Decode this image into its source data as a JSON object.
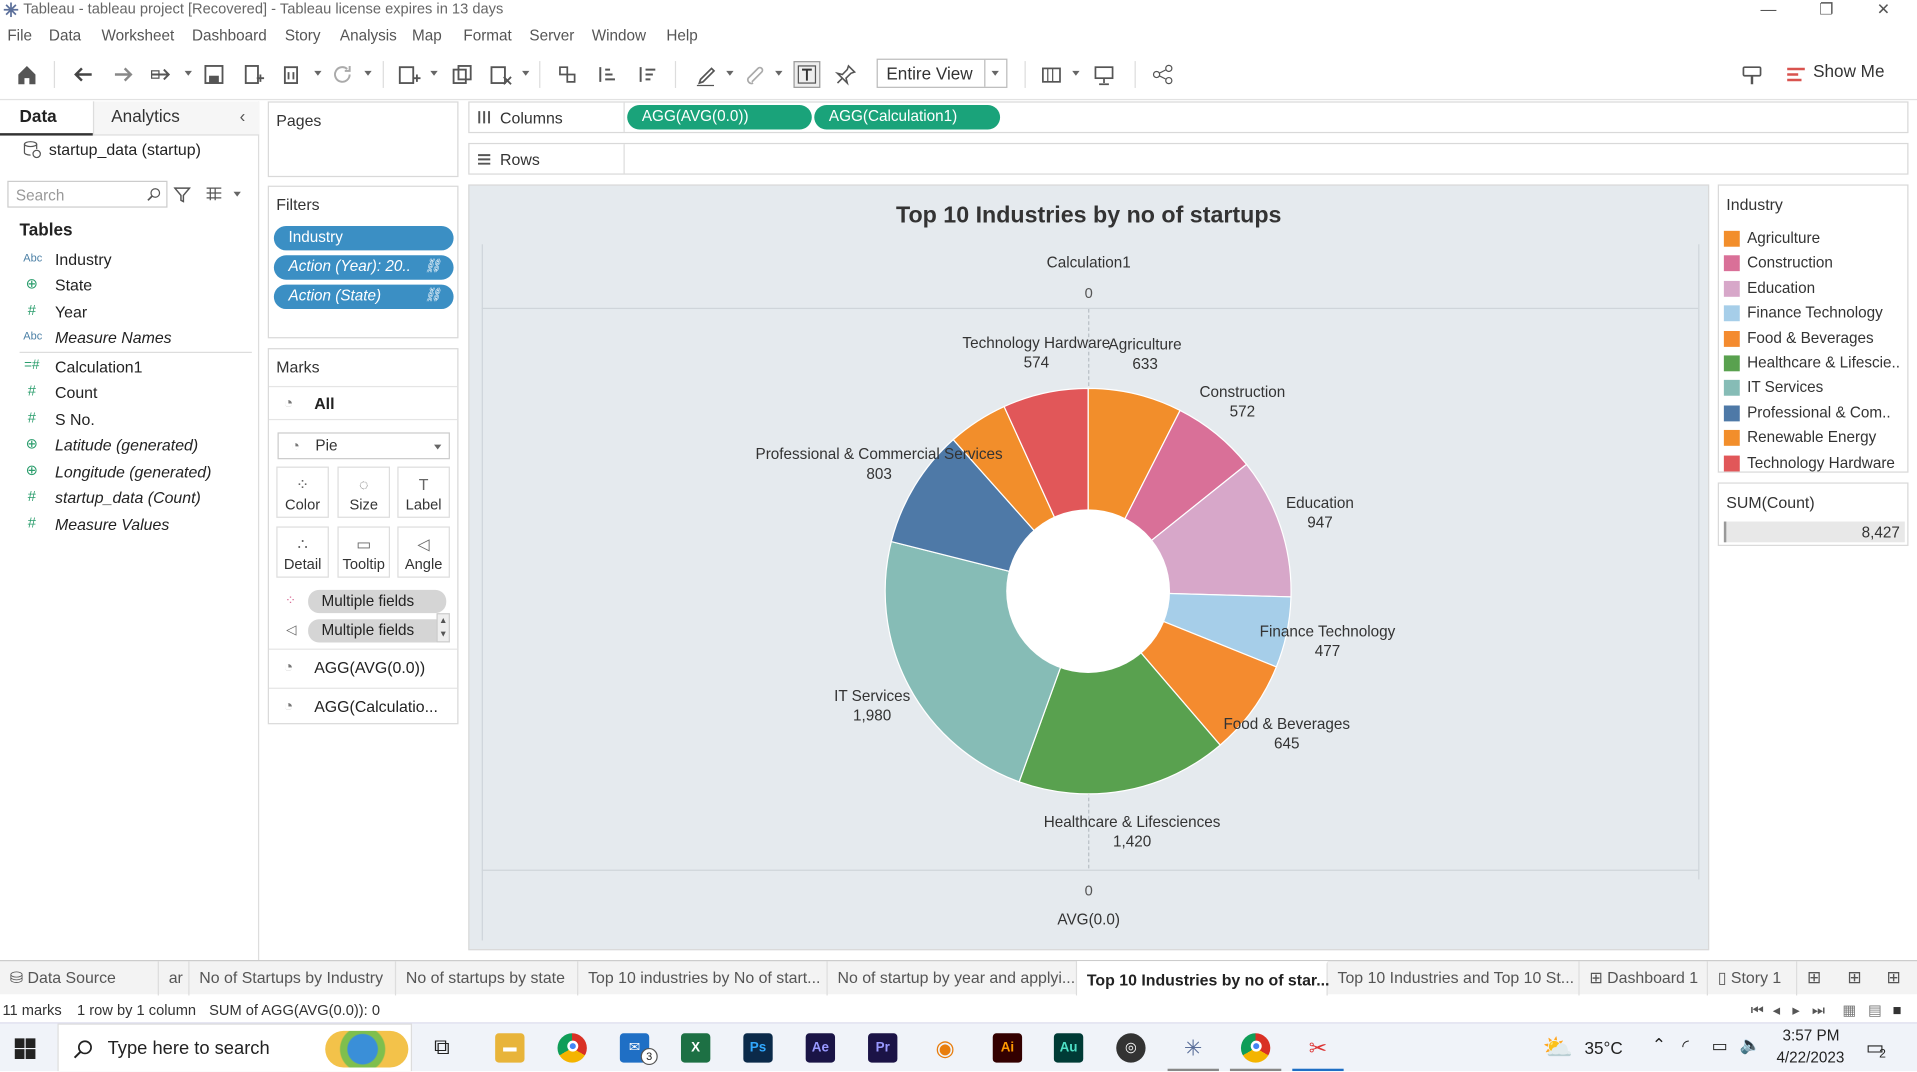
{
  "window": {
    "title": "Tableau - tableau project [Recovered] - Tableau license expires in 13 days"
  },
  "menu": [
    "File",
    "Data",
    "Worksheet",
    "Dashboard",
    "Story",
    "Analysis",
    "Map",
    "Format",
    "Server",
    "Window",
    "Help"
  ],
  "toolbar": {
    "fit": "Entire View",
    "show_me": "Show Me"
  },
  "left_pane": {
    "tabs": {
      "data": "Data",
      "analytics": "Analytics"
    },
    "datasource": "startup_data (startup)",
    "search_placeholder": "Search",
    "tables_label": "Tables",
    "fields": [
      {
        "icon": "Abc",
        "name": "Industry"
      },
      {
        "icon": "⊕",
        "name": "State"
      },
      {
        "icon": "#",
        "name": "Year"
      },
      {
        "icon": "Abc",
        "name": "Measure Names"
      },
      {
        "icon": "=#",
        "name": "Calculation1"
      },
      {
        "icon": "#",
        "name": "Count"
      },
      {
        "icon": "#",
        "name": "S No."
      },
      {
        "icon": "⊕",
        "name": "Latitude (generated)"
      },
      {
        "icon": "⊕",
        "name": "Longitude (generated)"
      },
      {
        "icon": "#",
        "name": "startup_data (Count)"
      },
      {
        "icon": "#",
        "name": "Measure Values"
      }
    ]
  },
  "shelves": {
    "pages": "Pages",
    "columns": "Columns",
    "rows": "Rows",
    "column_pills": [
      "AGG(AVG(0.0))",
      "AGG(Calculation1)"
    ],
    "filters": "Filters",
    "filter_pills": [
      "Industry",
      "Action (Year): 20..",
      "Action (State)"
    ]
  },
  "marks": {
    "title": "Marks",
    "all": "All",
    "type": "Pie",
    "buttons": [
      "Color",
      "Size",
      "Label",
      "Detail",
      "Tooltip",
      "Angle"
    ],
    "multi1": "Multiple fields",
    "multi2": "Multiple fields",
    "sub1": "AGG(AVG(0.0))",
    "sub2": "AGG(Calculatio..."
  },
  "viz": {
    "title": "Top 10 Industries by no of startups",
    "top_axis_title": "Calculation1",
    "top_axis_tick": "0",
    "bottom_axis_tick": "0",
    "bottom_axis_title": "AVG(0.0)"
  },
  "chart_data": {
    "type": "pie",
    "title": "Top 10 Industries by no of startups",
    "donut": true,
    "categories": [
      "Agriculture",
      "Construction",
      "Education",
      "Finance Technology",
      "Food & Beverages",
      "Healthcare & Lifesciences",
      "IT Services",
      "Professional & Commercial Services",
      "Renewable Energy",
      "Technology Hardware"
    ],
    "values": [
      633,
      572,
      947,
      477,
      645,
      1420,
      1980,
      803,
      null,
      574
    ],
    "display_values": [
      "633",
      "572",
      "947",
      "477",
      "645",
      "1,420",
      "1,980",
      "803",
      "",
      "574"
    ],
    "slice_order_values": [
      633,
      572,
      947,
      477,
      645,
      1420,
      1980,
      803,
      404,
      574
    ],
    "colors": [
      "#f28e2b",
      "#d97098",
      "#d7a7c9",
      "#a6cee9",
      "#f48b2f",
      "#59a14f",
      "#86bcb6",
      "#4e79a7",
      "#f28e2b",
      "#e15759"
    ],
    "total": "8,427"
  },
  "legend": {
    "title": "Industry",
    "items": [
      {
        "label": "Agriculture",
        "color": "#f28e2b"
      },
      {
        "label": "Construction",
        "color": "#d97098"
      },
      {
        "label": "Education",
        "color": "#d7a7c9"
      },
      {
        "label": "Finance Technology",
        "color": "#a6cee9"
      },
      {
        "label": "Food & Beverages",
        "color": "#f48b2f"
      },
      {
        "label": "Healthcare & Lifescie..",
        "color": "#59a14f"
      },
      {
        "label": "IT Services",
        "color": "#86bcb6"
      },
      {
        "label": "Professional & Com..",
        "color": "#4e79a7"
      },
      {
        "label": "Renewable Energy",
        "color": "#f28e2b"
      },
      {
        "label": "Technology Hardware",
        "color": "#e15759"
      }
    ]
  },
  "sum_card": {
    "title": "SUM(Count)",
    "value": "8,427"
  },
  "sheet_tabs": [
    "Data Source",
    "ar",
    "No of Startups by Industry",
    "No of startups by state",
    "Top 10 industries by No of start...",
    "No of startup by year and applyi...",
    "Top 10 Industries by no of star...",
    "Top 10 Industries and Top 10 St...",
    "Dashboard 1",
    "Story 1"
  ],
  "status": {
    "marks": "11 marks",
    "dims": "1 row by 1 column",
    "sum": "SUM of AGG(AVG(0.0)): 0"
  },
  "taskbar": {
    "search": "Type here to search",
    "temp": "35°C",
    "time": "3:57 PM",
    "date": "4/22/2023",
    "mail_badge": "3",
    "notif": "2"
  }
}
